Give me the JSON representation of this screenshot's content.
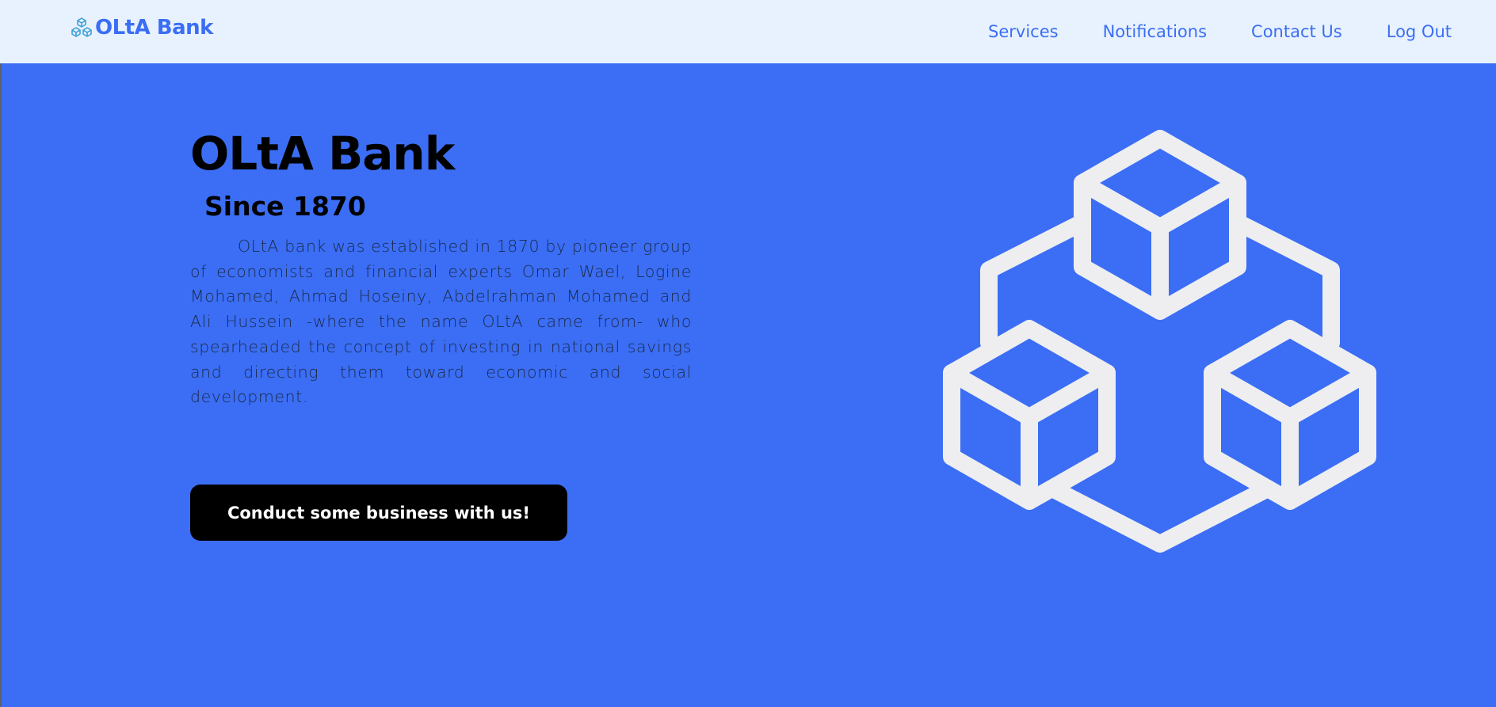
{
  "navbar": {
    "brand": {
      "name": "OLtA Bank",
      "icon": "cubes-icon"
    },
    "links": [
      {
        "label": "Services"
      },
      {
        "label": "Notifications"
      },
      {
        "label": "Contact Us"
      },
      {
        "label": "Log Out"
      }
    ]
  },
  "hero": {
    "title": "OLtA Bank",
    "subtitle": "Since 1870",
    "description": "OLtA bank was established in 1870 by pioneer group of economists and financial experts Omar Wael, Logine Mohamed, Ahmad Hoseiny, Abdelrahman Mohamed and Ali Hussein -where the name OLtA came from- who spearheaded the concept of investing in national savings and directing them toward economic and social development.",
    "cta_label": "Conduct some business with us!",
    "illustration": "cubes-illustration"
  },
  "colors": {
    "primary": "#3b6ef5",
    "navbar_bg": "#e8f2fe",
    "button_bg": "#000000",
    "cube_stroke": "#eeeef0"
  }
}
